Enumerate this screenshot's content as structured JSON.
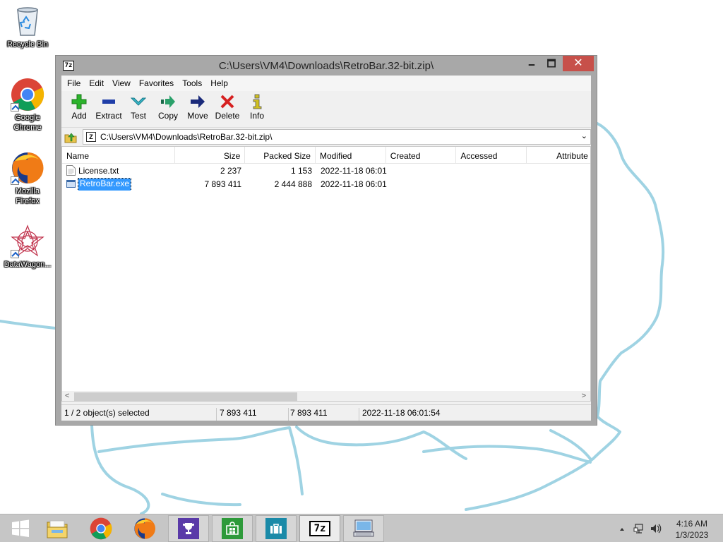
{
  "desktop": {
    "icons": [
      {
        "label": "Recycle Bin",
        "icon": "recycle-bin-icon"
      },
      {
        "label": "Google Chrome",
        "icon": "chrome-icon"
      },
      {
        "label": "Mozilla Firefox",
        "icon": "firefox-icon"
      },
      {
        "label": "DataWagon...",
        "icon": "datawagon-icon"
      }
    ],
    "scribble_color": "#9fd3e3"
  },
  "window": {
    "title": "C:\\Users\\VM4\\Downloads\\RetroBar.32-bit.zip\\",
    "app_icon_text": "7z",
    "min_glyph": "🗕",
    "max_glyph": "🗖",
    "close_glyph": "✕",
    "close_color": "#c7504a",
    "menu": [
      "File",
      "Edit",
      "View",
      "Favorites",
      "Tools",
      "Help"
    ],
    "toolbar": [
      {
        "label": "Add",
        "icon": "plus-icon",
        "color": "#2bb32b"
      },
      {
        "label": "Extract",
        "icon": "minus-icon",
        "color": "#1f3ea8"
      },
      {
        "label": "Test",
        "icon": "check-chevron-icon",
        "color": "#39b8c8"
      },
      {
        "label": "Copy",
        "icon": "copy-arrow-icon",
        "color": "#2aa06a"
      },
      {
        "label": "Move",
        "icon": "move-arrow-icon",
        "color": "#1a2a7a"
      },
      {
        "label": "Delete",
        "icon": "delete-x-icon",
        "color": "#d62020"
      },
      {
        "label": "Info",
        "icon": "info-icon",
        "color": "#d0c020"
      }
    ],
    "address": {
      "path": "C:\\Users\\VM4\\Downloads\\RetroBar.32-bit.zip\\",
      "dropdown_glyph": "⌄"
    },
    "columns": [
      "Name",
      "Size",
      "Packed Size",
      "Modified",
      "Created",
      "Accessed",
      "Attribute"
    ],
    "files": [
      {
        "name": "License.txt",
        "size": "2 237",
        "packed": "1 153",
        "modified": "2022-11-18 06:01",
        "selected": false,
        "icon": "text-file-icon"
      },
      {
        "name": "RetroBar.exe",
        "size": "7 893 411",
        "packed": "2 444 888",
        "modified": "2022-11-18 06:01",
        "selected": true,
        "icon": "exe-file-icon"
      }
    ],
    "scroll": {
      "left_glyph": "<",
      "right_glyph": ">"
    },
    "status": {
      "selection": "1 / 2 object(s) selected",
      "size": "7 893 411",
      "packed": "7 893 411",
      "modified": "2022-11-18 06:01:54"
    }
  },
  "taskbar": {
    "items": [
      {
        "name": "start-button",
        "icon": "windows-logo-icon"
      },
      {
        "name": "file-explorer",
        "icon": "folder-icon"
      },
      {
        "name": "chrome",
        "icon": "chrome-icon"
      },
      {
        "name": "firefox",
        "icon": "firefox-icon"
      },
      {
        "name": "achievements",
        "icon": "trophy-icon"
      },
      {
        "name": "store",
        "icon": "store-icon"
      },
      {
        "name": "briefcase",
        "icon": "briefcase-icon"
      },
      {
        "name": "7zip",
        "icon": "sevenzip-icon"
      },
      {
        "name": "computer",
        "icon": "computer-icon"
      }
    ],
    "clock": {
      "time": "4:16 AM",
      "date": "1/3/2023"
    }
  }
}
